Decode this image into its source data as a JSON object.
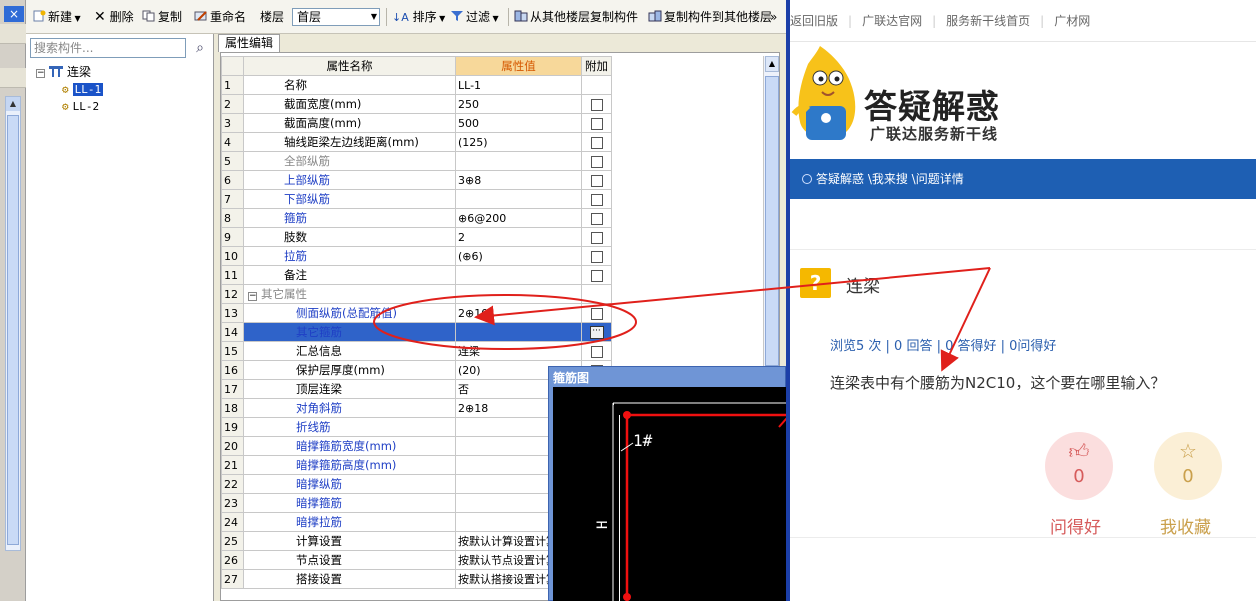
{
  "toolbar": {
    "new_label": "新建",
    "delete_label": "删除",
    "copy_label": "复制",
    "rename_label": "重命名",
    "floor_label": "楼层",
    "floor_value": "首层",
    "sort_label": "排序",
    "filter_label": "过滤",
    "copy_from_label": "从其他楼层复制构件",
    "copy_to_label": "复制构件到其他楼层",
    "more_label": "»"
  },
  "left_strip": {
    "close_label": "×"
  },
  "component_panel": {
    "search_placeholder": "搜索构件...",
    "tree_root": "连梁",
    "tree_items": [
      "LL-1",
      "LL-2"
    ]
  },
  "prop_editor": {
    "tab_label": "属性编辑",
    "col_name": "属性名称",
    "col_value": "属性值",
    "col_extra": "附加",
    "rows": [
      {
        "n": "1",
        "name": "名称",
        "value": "LL-1"
      },
      {
        "n": "2",
        "name": "截面宽度(mm)",
        "value": "250"
      },
      {
        "n": "3",
        "name": "截面高度(mm)",
        "value": "500"
      },
      {
        "n": "4",
        "name": "轴线距梁左边线距离(mm)",
        "value": "(125)"
      },
      {
        "n": "5",
        "name": "全部纵筋",
        "value": ""
      },
      {
        "n": "6",
        "name": "上部纵筋",
        "value": "3⊕8"
      },
      {
        "n": "7",
        "name": "下部纵筋",
        "value": ""
      },
      {
        "n": "8",
        "name": "箍筋",
        "value": "⊕6@200"
      },
      {
        "n": "9",
        "name": "肢数",
        "value": "2"
      },
      {
        "n": "10",
        "name": "拉筋",
        "value": "(⊕6)"
      },
      {
        "n": "11",
        "name": "备注",
        "value": ""
      },
      {
        "n": "12",
        "name": "其它属性",
        "value": ""
      },
      {
        "n": "13",
        "name": "侧面纵筋(总配筋值)",
        "value": "2⊕10"
      },
      {
        "n": "14",
        "name": "其它箍筋",
        "value": ""
      },
      {
        "n": "15",
        "name": "汇总信息",
        "value": "连梁"
      },
      {
        "n": "16",
        "name": "保护层厚度(mm)",
        "value": "(20)"
      },
      {
        "n": "17",
        "name": "顶层连梁",
        "value": "否"
      },
      {
        "n": "18",
        "name": "对角斜筋",
        "value": "2⊕18"
      },
      {
        "n": "19",
        "name": "折线筋",
        "value": ""
      },
      {
        "n": "20",
        "name": "暗撑箍筋宽度(mm)",
        "value": ""
      },
      {
        "n": "21",
        "name": "暗撑箍筋高度(mm)",
        "value": ""
      },
      {
        "n": "22",
        "name": "暗撑纵筋",
        "value": ""
      },
      {
        "n": "23",
        "name": "暗撑箍筋",
        "value": ""
      },
      {
        "n": "24",
        "name": "暗撑拉筋",
        "value": ""
      },
      {
        "n": "25",
        "name": "计算设置",
        "value": "按默认计算设置计算"
      },
      {
        "n": "26",
        "name": "节点设置",
        "value": "按默认节点设置计算"
      },
      {
        "n": "27",
        "name": "搭接设置",
        "value": "按默认搭接设置计算"
      }
    ],
    "dots_label": "···",
    "collapse_label": "−"
  },
  "stirrup_window": {
    "title": "箍筋图",
    "label_1": "1#",
    "label_h": "H"
  },
  "web": {
    "nav": [
      "返回旧版",
      "广联达官网",
      "服务新干线首页",
      "广材网"
    ],
    "brand_title": "答疑解惑",
    "brand_sub": "广联达服务新干线",
    "breadcrumb": "答疑解惑 \\我来搜 \\问题详情",
    "question_badge": "?",
    "question_title": "连梁",
    "stats": "浏览5 次 | 0 回答 | 0 答得好 | 0问得好",
    "question_body": "连梁表中有个腰筋为N2C10，这个要在哪里输入？",
    "good_count": "0",
    "fav_count": "0",
    "good_label": "问得好",
    "fav_label": "我收藏"
  },
  "colors": {
    "selection": "#2f63c9",
    "value_header": "#f7d89a",
    "brand_blue": "#1e5fb3",
    "annotation_red": "#e0201b"
  }
}
